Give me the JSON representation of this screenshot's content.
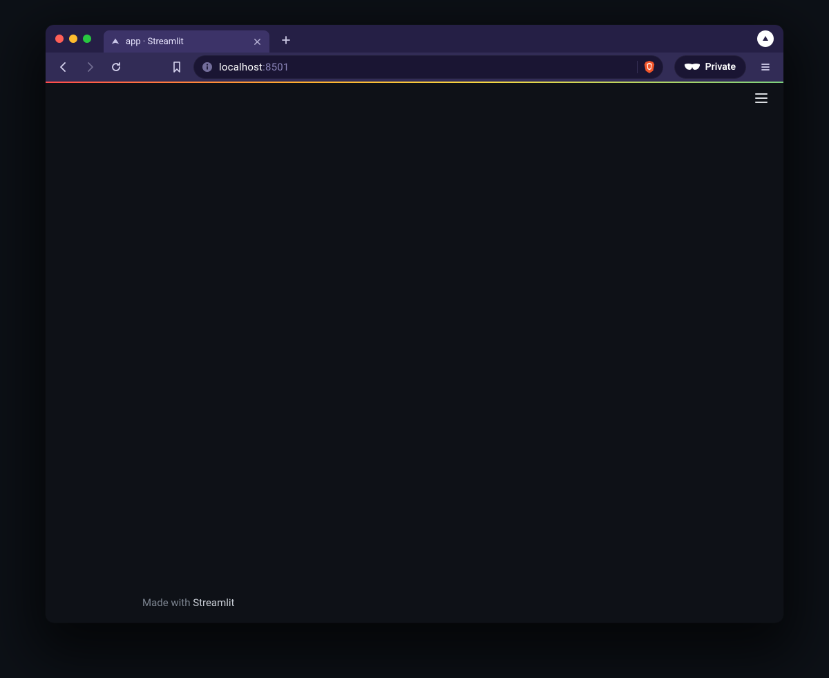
{
  "browser": {
    "tab": {
      "title": "app · Streamlit"
    },
    "address": {
      "host": "localhost",
      "port": ":8501"
    },
    "private_label": "Private"
  },
  "app": {
    "footer_prefix": "Made with ",
    "footer_brand": "Streamlit"
  }
}
